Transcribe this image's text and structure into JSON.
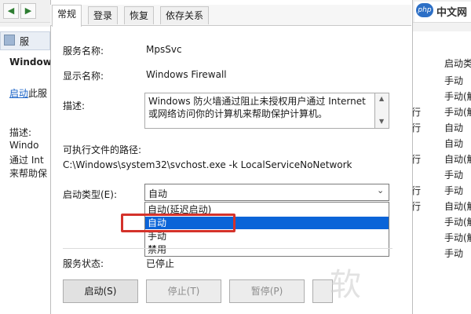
{
  "background": {
    "left_panel": {
      "header": "服",
      "title": "Window",
      "link_start": "启动",
      "link_rest": "此服",
      "desc_label": "描述:",
      "desc_lines": [
        "Windo",
        "通过 Int",
        "来帮助保"
      ]
    },
    "right_panel": {
      "header": "启动类",
      "rows": [
        {
          "col1": "",
          "col2": "手动"
        },
        {
          "col1": "",
          "col2": "手动(触"
        },
        {
          "col1": "行",
          "col2": "手动(触"
        },
        {
          "col1": "行",
          "col2": "自动"
        },
        {
          "col1": "",
          "col2": "自动"
        },
        {
          "col1": "行",
          "col2": "自动(触"
        },
        {
          "col1": "",
          "col2": "手动"
        },
        {
          "col1": "行",
          "col2": "手动"
        },
        {
          "col1": "行",
          "col2": "自动(触"
        },
        {
          "col1": "",
          "col2": "手动(触"
        },
        {
          "col1": "",
          "col2": "手动(触"
        },
        {
          "col1": "",
          "col2": "手动"
        }
      ]
    },
    "toolbar_icons": [
      "back-arrow",
      "forward-arrow"
    ]
  },
  "logo": {
    "badge": "php",
    "text": "中文网"
  },
  "dialog": {
    "tabs": [
      {
        "label": "常规",
        "active": true
      },
      {
        "label": "登录",
        "active": false
      },
      {
        "label": "恢复",
        "active": false
      },
      {
        "label": "依存关系",
        "active": false
      }
    ],
    "service_name_label": "服务名称:",
    "service_name": "MpsSvc",
    "display_name_label": "显示名称:",
    "display_name": "Windows Firewall",
    "description_label": "描述:",
    "description": "Windows 防火墙通过阻止未授权用户通过 Internet 或网络访问你的计算机来帮助保护计算机。",
    "exe_path_label": "可执行文件的路径:",
    "exe_path": "C:\\Windows\\system32\\svchost.exe -k LocalServiceNoNetwork",
    "startup_type_label": "启动类型(E):",
    "startup_type_value": "自动",
    "startup_options": [
      {
        "label": "自动(延迟启动)",
        "selected": false
      },
      {
        "label": "自动",
        "selected": true
      },
      {
        "label": "手动",
        "selected": false
      },
      {
        "label": "禁用",
        "selected": false
      }
    ],
    "service_status_label": "服务状态:",
    "service_status": "已停止",
    "buttons": {
      "start": "启动(S)",
      "stop": "停止(T)",
      "pause": "暂停(P)",
      "resume": ""
    },
    "accent_color": "#0a64d8",
    "highlight_color": "#d4322b"
  },
  "watermark": "软"
}
